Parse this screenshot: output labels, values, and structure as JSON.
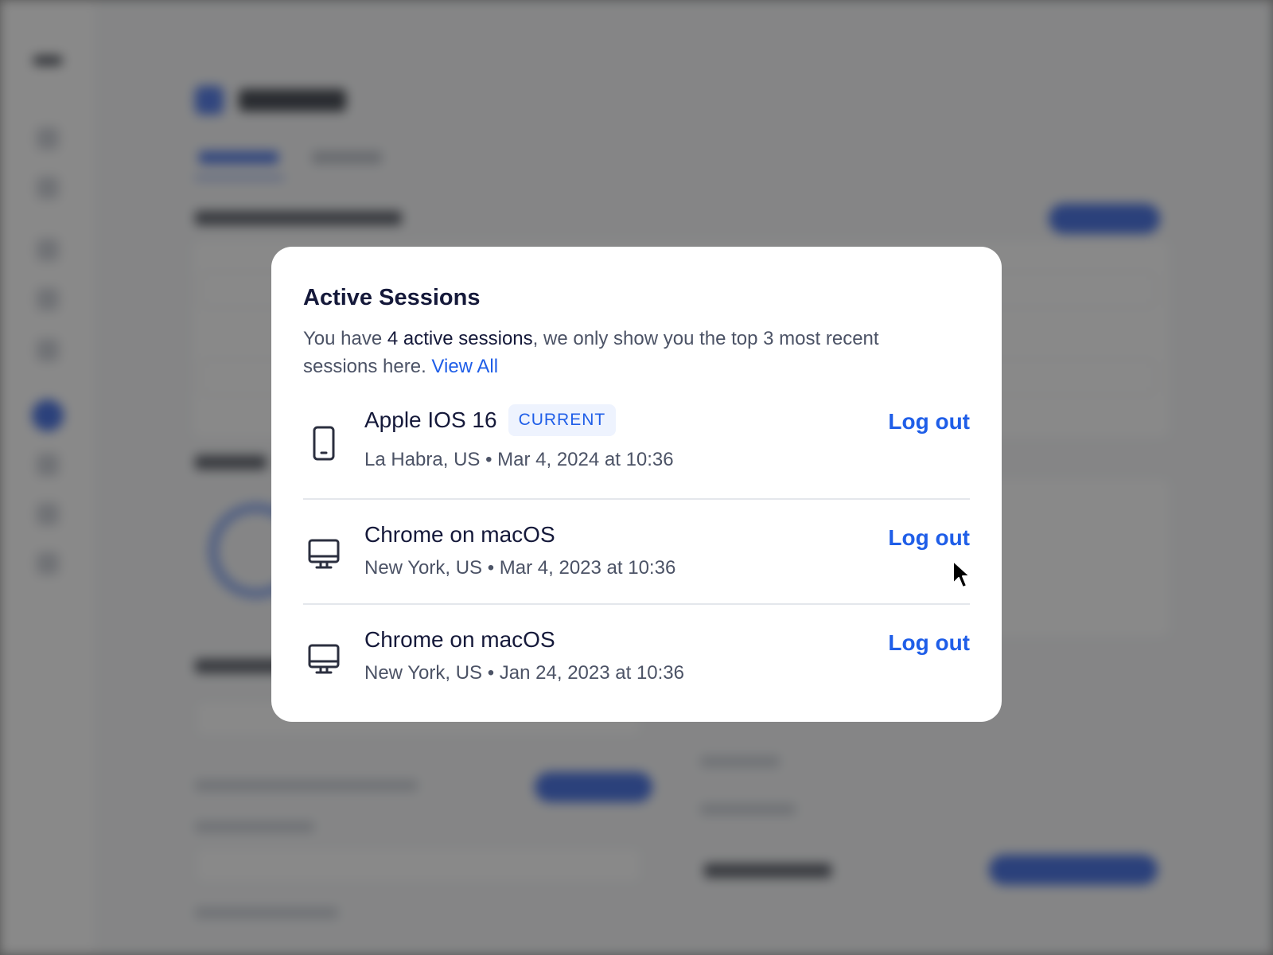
{
  "modal": {
    "title": "Active Sessions",
    "desc_prefix": "You have ",
    "desc_strong": "4 active sessions",
    "desc_suffix": ", we only show you the top 3 most recent sessions here. ",
    "view_all_label": "View All"
  },
  "sessions": [
    {
      "device_icon": "smartphone-icon",
      "name": "Apple IOS 16",
      "badge": "CURRENT",
      "meta": "La Habra, US • Mar 4, 2024 at 10:36",
      "logout_label": "Log out"
    },
    {
      "device_icon": "desktop-icon",
      "name": "Chrome on macOS",
      "meta": "New York, US • Mar 4, 2023 at 10:36",
      "logout_label": "Log out"
    },
    {
      "device_icon": "desktop-icon",
      "name": "Chrome on macOS",
      "meta": "New York, US • Jan 24, 2023 at 10:36",
      "logout_label": "Log out"
    }
  ],
  "colors": {
    "accent": "#1f5ee8",
    "title": "#15193a",
    "muted": "#4c5366",
    "badge_bg": "#eef3fe",
    "overlay": "#808080"
  }
}
